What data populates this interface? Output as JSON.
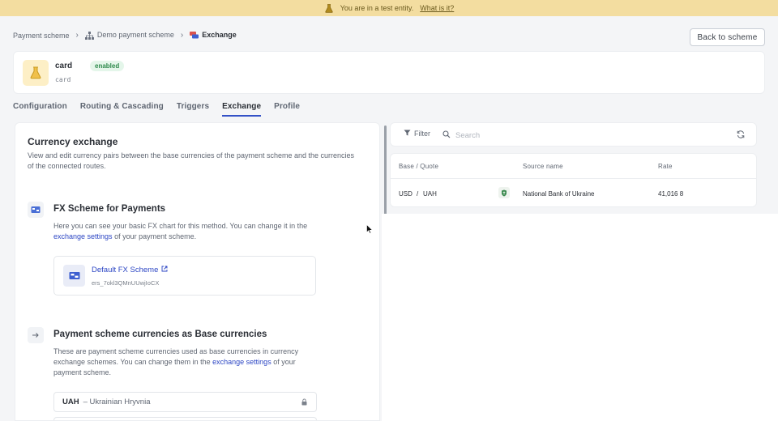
{
  "banner": {
    "text": "You are in a test entity.",
    "link": "What is it?",
    "icon": "flask-icon"
  },
  "breadcrumb": {
    "items": [
      {
        "label": "Payment scheme"
      },
      {
        "label": "Demo payment scheme",
        "icon": "hierarchy-icon"
      },
      {
        "label": "Exchange",
        "icon": "exchange-icon"
      }
    ]
  },
  "header": {
    "back_button": "Back to scheme"
  },
  "entity": {
    "name": "card",
    "status": "enabled",
    "code": "card",
    "icon": "flask-icon"
  },
  "tabs": [
    {
      "label": "Configuration"
    },
    {
      "label": "Routing & Cascading"
    },
    {
      "label": "Triggers"
    },
    {
      "label": "Exchange",
      "active": true
    },
    {
      "label": "Profile"
    }
  ],
  "currency_exchange": {
    "title": "Currency exchange",
    "description": "View and edit currency pairs between the base currencies of the payment scheme and the currencies of the connected routes."
  },
  "fx_section": {
    "title": "FX Scheme for Payments",
    "desc_before": "Here you can see your basic FX chart for this method. You can change it in the ",
    "desc_link": "exchange settings",
    "desc_after": " of your payment scheme.",
    "card": {
      "title": "Default FX Scheme",
      "id": "ers_7okl3QMnUUwjIoCX"
    }
  },
  "base_section": {
    "title": "Payment scheme currencies as Base currencies",
    "desc_before": "These are payment scheme currencies used as base currencies in currency exchange schemes. You can change them in the ",
    "desc_link": "exchange settings",
    "desc_after": " of your payment scheme.",
    "currencies": [
      {
        "code": "UAH",
        "name": "– Ukrainian Hryvnia"
      }
    ]
  },
  "rates_panel": {
    "filter_label": "Filter",
    "search_placeholder": "Search",
    "columns": [
      "Base / Quote",
      "Source name",
      "Rate"
    ],
    "rows": [
      {
        "base": "USD",
        "sep": "/",
        "quote": "UAH",
        "source": "National Bank of Ukraine",
        "rate": "41,016 8"
      }
    ]
  },
  "colors": {
    "accent": "#3452c7",
    "link": "#2c46c4",
    "banner_bg": "#f3dda0",
    "enabled_green": "#2e8a4c"
  }
}
